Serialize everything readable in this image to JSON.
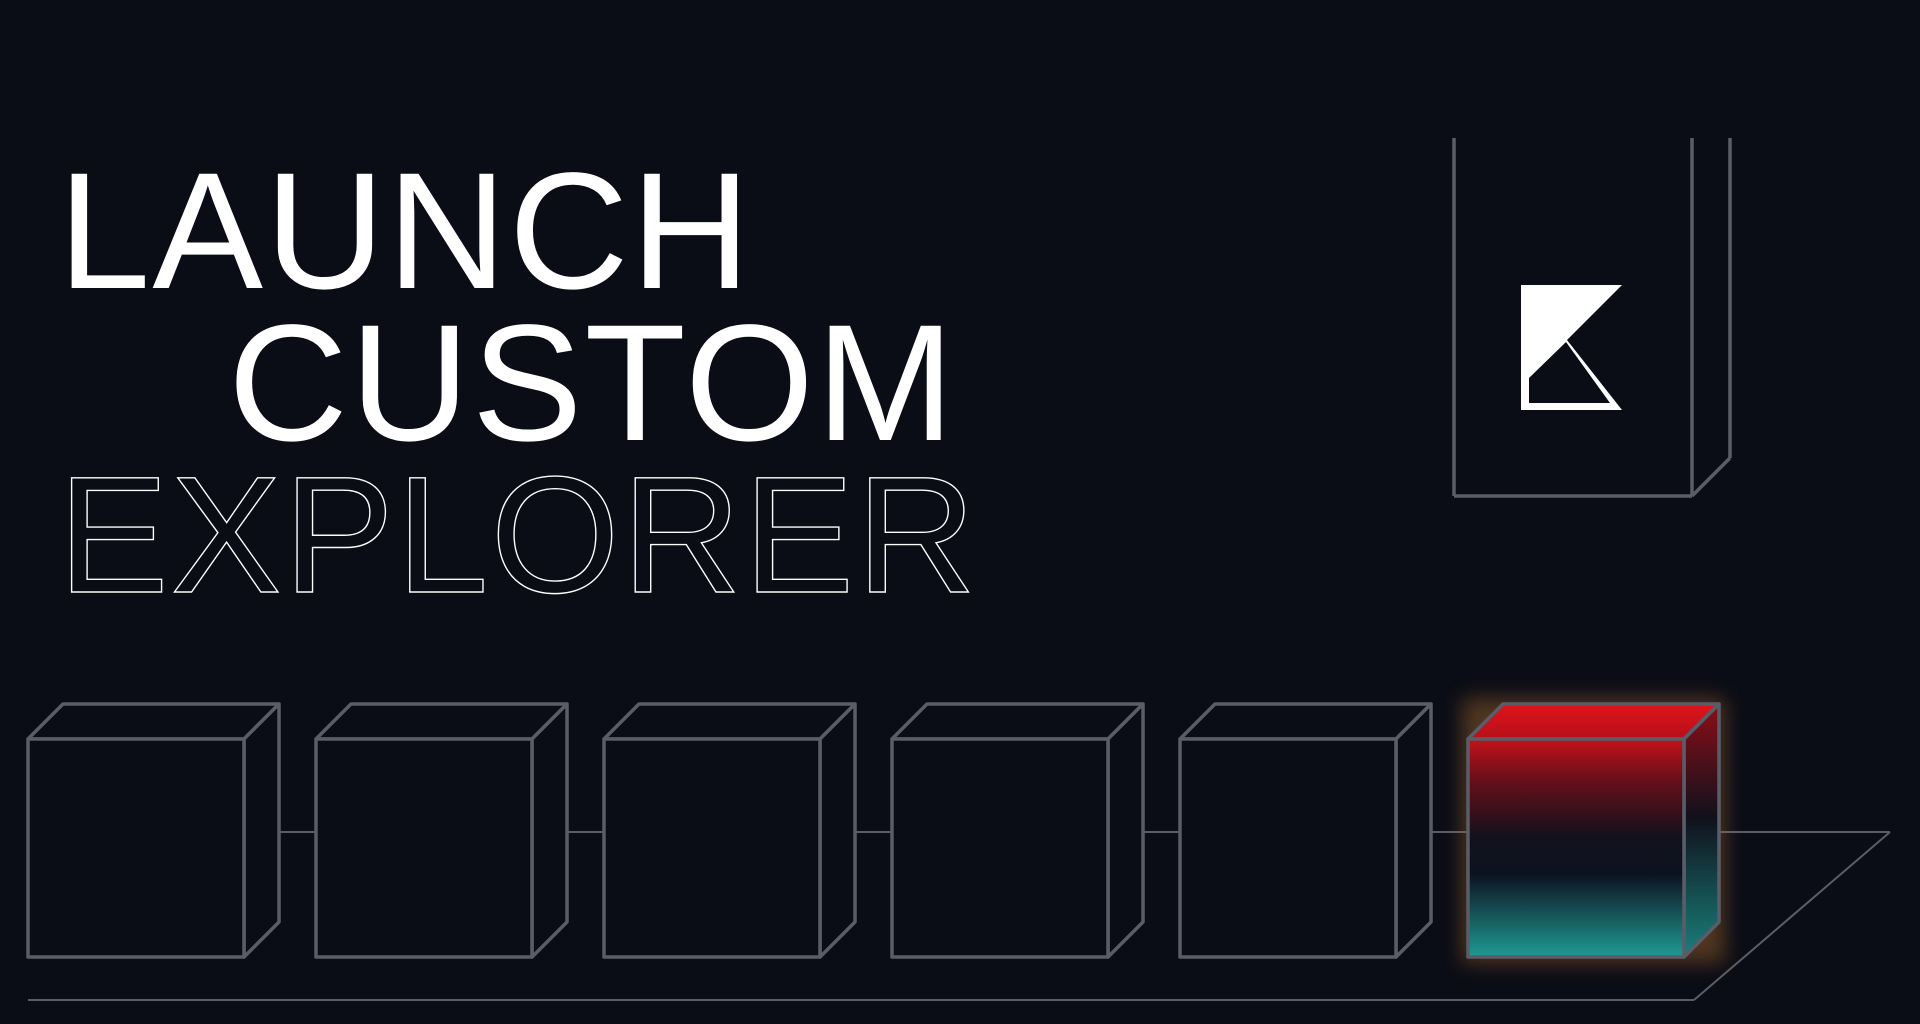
{
  "headline": {
    "line1": "LAUNCH",
    "line2": "CUSTOM",
    "line3": "EXPLORER"
  },
  "logo": {
    "icon": "k-logo-icon"
  },
  "blocks": {
    "count": 6,
    "highlighted_index": 5
  },
  "colors": {
    "background": "#0a0c16",
    "text": "#ffffff",
    "frame_stroke": "#5a5d68",
    "accent_red": "#d40f14",
    "accent_teal": "#22a39b"
  }
}
